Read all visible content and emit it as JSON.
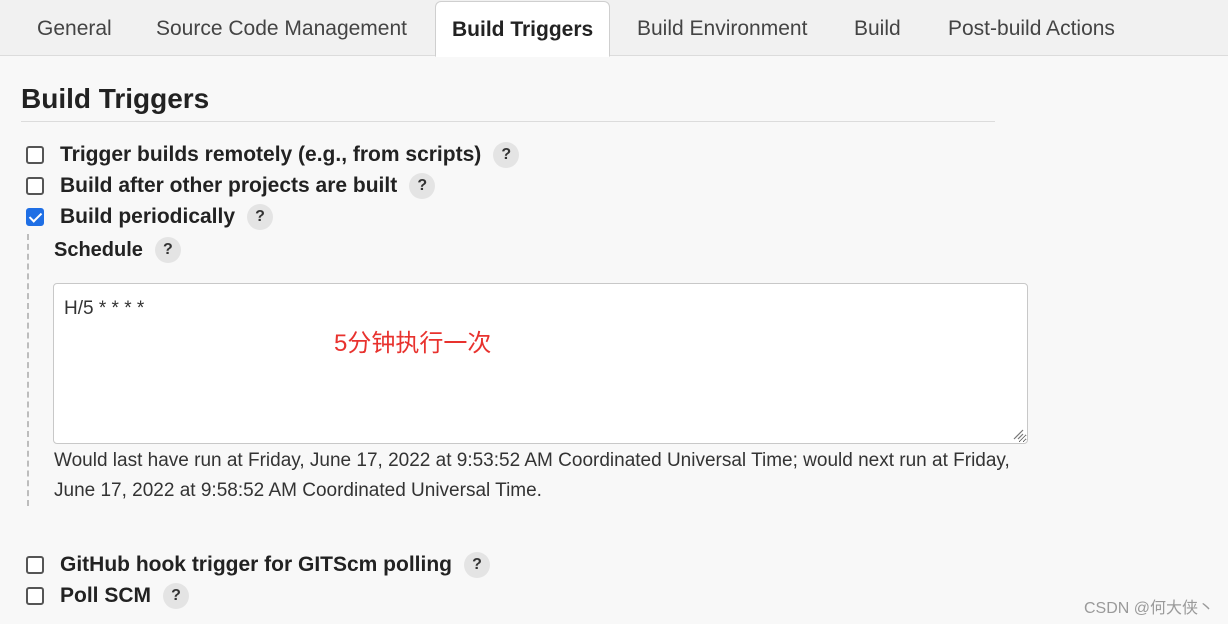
{
  "tabs": [
    {
      "label": "General"
    },
    {
      "label": "Source Code Management"
    },
    {
      "label": "Build Triggers",
      "active": true
    },
    {
      "label": "Build Environment"
    },
    {
      "label": "Build"
    },
    {
      "label": "Post-build Actions"
    }
  ],
  "section": {
    "title": "Build Triggers"
  },
  "triggers": [
    {
      "label": "Trigger builds remotely (e.g., from scripts)",
      "checked": false
    },
    {
      "label": "Build after other projects are built",
      "checked": false
    },
    {
      "label": "Build periodically",
      "checked": true
    },
    {
      "label": "GitHub hook trigger for GITScm polling",
      "checked": false
    },
    {
      "label": "Poll SCM",
      "checked": false
    }
  ],
  "schedule": {
    "label": "Schedule",
    "value": "H/5 * * * *",
    "annotation": "5分钟执行一次",
    "hint": "Would last have run at Friday, June 17, 2022 at 9:53:52 AM Coordinated Universal Time; would next run at Friday, June 17, 2022 at 9:58:52 AM Coordinated Universal Time."
  },
  "help_glyph": "?",
  "watermark": "CSDN @何大侠丶",
  "colors": {
    "accent": "#1f6fe5",
    "annotation": "#e8322e",
    "page_bg": "#f8f8f8",
    "tab_bar_bg": "#f1f1f1"
  },
  "icons": {
    "help": "help-icon",
    "checkbox": "checkbox",
    "resize": "resize-grip-icon"
  }
}
